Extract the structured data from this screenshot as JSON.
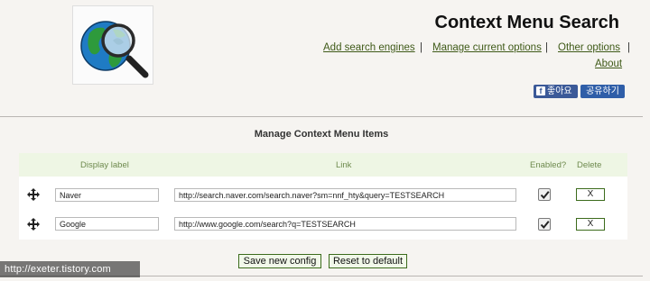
{
  "app": {
    "title": "Context Menu Search",
    "logo_icon": "globe-magnifier-icon"
  },
  "nav": {
    "links": [
      "Add search engines",
      "Manage current options",
      "Other options",
      "About"
    ],
    "separator": "|"
  },
  "share": {
    "facebook_label": "좋아요",
    "share_label": "공유하기"
  },
  "section": {
    "title": "Manage Context Menu Items"
  },
  "table": {
    "headers": {
      "label": "Display label",
      "link": "Link",
      "enabled": "Enabled?",
      "delete": "Delete"
    },
    "rows": [
      {
        "label": "Naver",
        "link": "http://search.naver.com/search.naver?sm=nnf_hty&query=TESTSEARCH",
        "enabled": true,
        "delete_label": "X"
      },
      {
        "label": "Google",
        "link": "http://www.google.com/search?q=TESTSEARCH",
        "enabled": true,
        "delete_label": "X"
      }
    ]
  },
  "actions": {
    "save_label": "Save new config",
    "reset_label": "Reset to default"
  },
  "watermark": "http://exeter.tistory.com",
  "colors": {
    "link": "#3f5a18",
    "header_bg": "#eef6e4",
    "header_text": "#6e8a4e",
    "button_border": "#3c6b1c",
    "facebook": "#3b5998"
  }
}
